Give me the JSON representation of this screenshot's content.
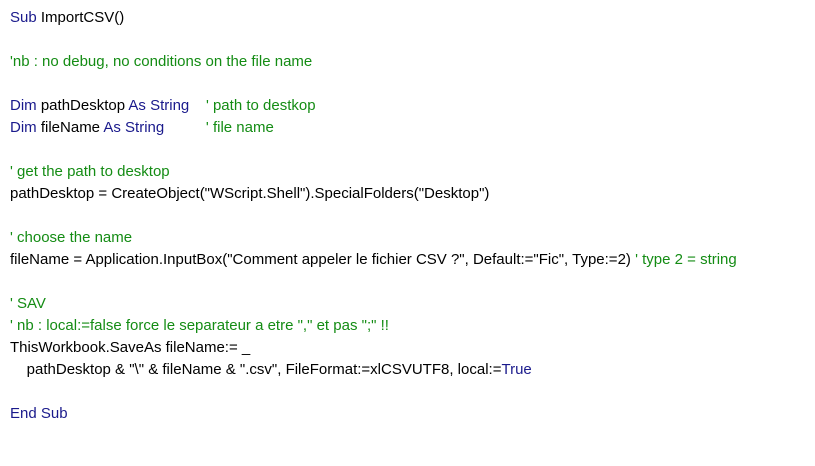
{
  "colors": {
    "keyword": "#1a1a8c",
    "comment": "#148c14",
    "text": "#000000",
    "background": "#ffffff"
  },
  "code": {
    "l1_kw": "Sub",
    "l1_tx": " ImportCSV()",
    "l2_cm": "'nb : no debug, no conditions on the file name",
    "l3_kw1": "Dim",
    "l3_tx1": " pathDesktop ",
    "l3_kw2": "As String",
    "l3_pad": "    ",
    "l3_cm": "' path to destkop",
    "l4_kw1": "Dim",
    "l4_tx1": " fileName ",
    "l4_kw2": "As String",
    "l4_pad": "          ",
    "l4_cm": "' file name",
    "l5_cm": "' get the path to desktop",
    "l6_tx": "pathDesktop = CreateObject(\"WScript.Shell\").SpecialFolders(\"Desktop\")",
    "l7_cm": "' choose the name",
    "l8_tx": "fileName = Application.InputBox(\"Comment appeler le fichier CSV ?\", Default:=\"Fic\", Type:=2) ",
    "l8_cm": "' type 2 = string",
    "l9_cm": "' SAV",
    "l10_cm": "' nb : local:=false force le separateur a etre \",\" et pas \";\" !!",
    "l11_tx": "ThisWorkbook.SaveAs fileName:= _",
    "l12_tx": "    pathDesktop & \"\\\" & fileName & \".csv\", FileFormat:=xlCSVUTF8, local:=",
    "l12_kw": "True",
    "l13_kw": "End Sub"
  }
}
